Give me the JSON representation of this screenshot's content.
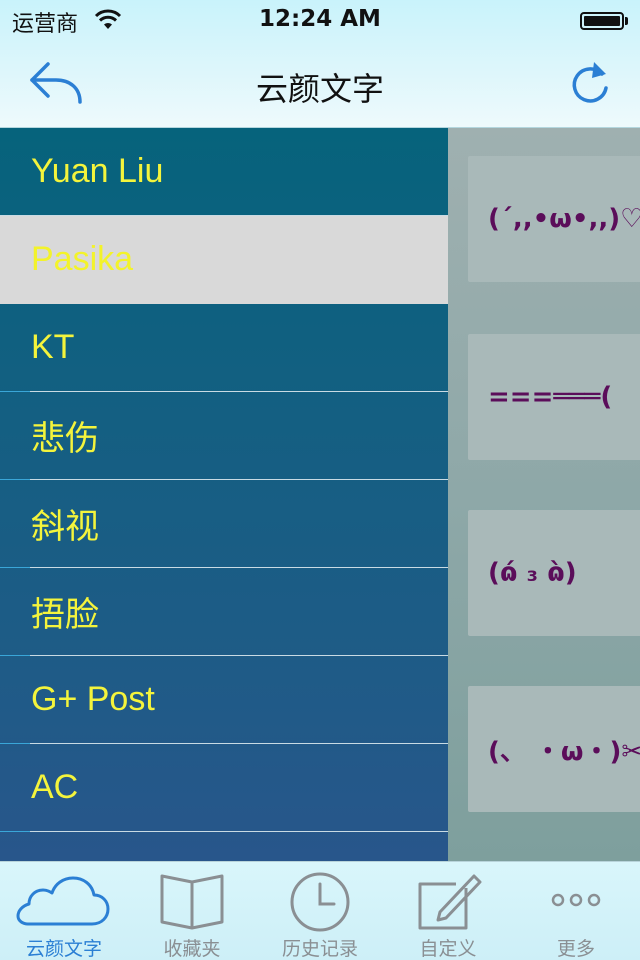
{
  "status_bar": {
    "carrier": "运营商",
    "time": "12:24 AM"
  },
  "nav": {
    "title": "云颜文字",
    "back_icon": "back-arrow-icon",
    "refresh_icon": "refresh-icon"
  },
  "menu": {
    "items": [
      {
        "label": "Yuan Liu",
        "selected": false
      },
      {
        "label": "Pasika",
        "selected": true
      },
      {
        "label": "KT",
        "selected": false
      },
      {
        "label": "悲伤",
        "selected": false
      },
      {
        "label": "斜视",
        "selected": false
      },
      {
        "label": "捂脸",
        "selected": false
      },
      {
        "label": "G+ Post",
        "selected": false
      },
      {
        "label": "AC",
        "selected": false
      }
    ]
  },
  "emoticons": [
    "(´,,•ω•,,)♡",
    "===═══(",
    "(ɷ́ ₃ ɷ̀)",
    "(、 ・ω・)✂"
  ],
  "tabs": [
    {
      "label": "云颜文字",
      "icon": "cloud-icon",
      "active": true
    },
    {
      "label": "收藏夹",
      "icon": "book-icon",
      "active": false
    },
    {
      "label": "历史记录",
      "icon": "clock-icon",
      "active": false
    },
    {
      "label": "自定义",
      "icon": "edit-icon",
      "active": false
    },
    {
      "label": "更多",
      "icon": "more-icon",
      "active": false
    }
  ],
  "colors": {
    "accent": "#2b7fd4",
    "menu_text": "#f4f43c",
    "emoticon_text": "#5b0d5a"
  }
}
